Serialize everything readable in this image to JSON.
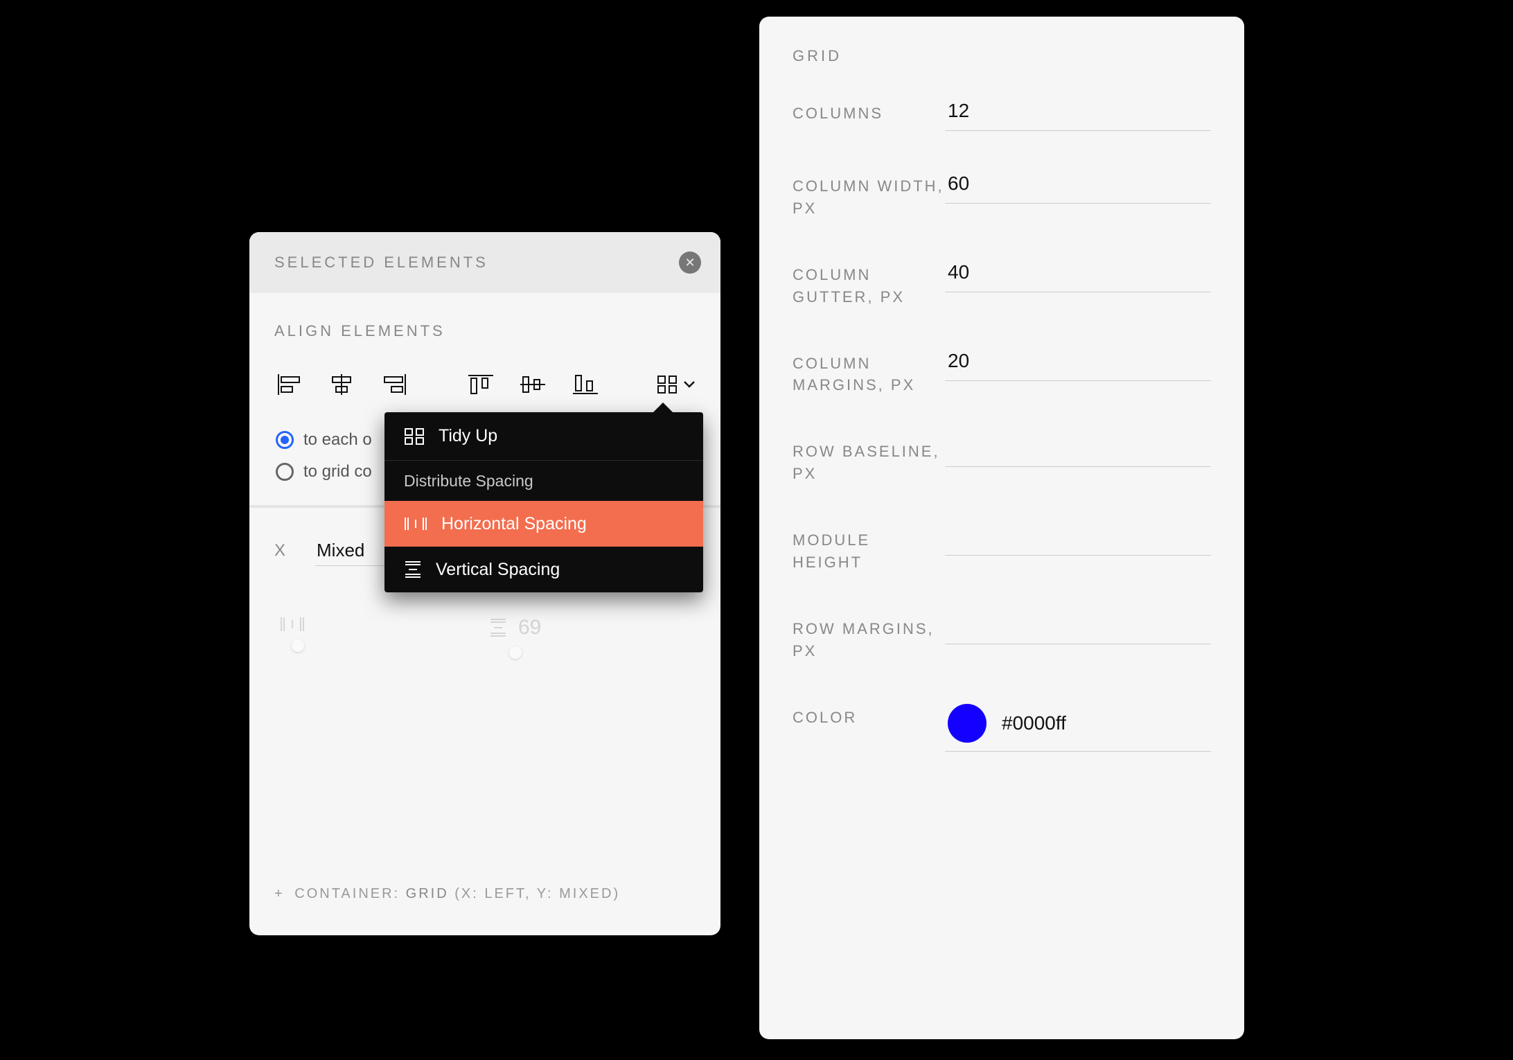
{
  "panel_left": {
    "title": "SELECTED ELEMENTS",
    "section_align": "ALIGN ELEMENTS",
    "radios": {
      "each_other": "to each o",
      "grid_cols": "to grid co"
    },
    "coords": {
      "x_label": "X",
      "x_value": "Mixed"
    },
    "gaps": {
      "h_value": "",
      "v_value": "69"
    },
    "container_line": {
      "plus": "+",
      "prefix": "CONTAINER: ",
      "name": "GRID",
      "details": " (X: LEFT, Y: MIXED)"
    }
  },
  "menu": {
    "tidy": "Tidy Up",
    "group_label": "Distribute Spacing",
    "h_spacing": "Horizontal Spacing",
    "v_spacing": "Vertical Spacing"
  },
  "panel_right": {
    "heading": "GRID",
    "rows": {
      "columns": {
        "label": "COLUMNS",
        "value": "12"
      },
      "col_width": {
        "label": "COLUMN WIDTH, PX",
        "value": "60"
      },
      "col_gutter": {
        "label": "COLUMN GUTTER, PX",
        "value": "40"
      },
      "col_margins": {
        "label": "COLUMN MARGINS, PX",
        "value": "20"
      },
      "row_baseline": {
        "label": "ROW BASELINE, PX",
        "value": ""
      },
      "module_height": {
        "label": "MODULE HEIGHT",
        "value": ""
      },
      "row_margins": {
        "label": "ROW MARGINS, PX",
        "value": ""
      },
      "color": {
        "label": "COLOR",
        "value": "#0000ff",
        "swatch": "#1400ff"
      }
    }
  }
}
